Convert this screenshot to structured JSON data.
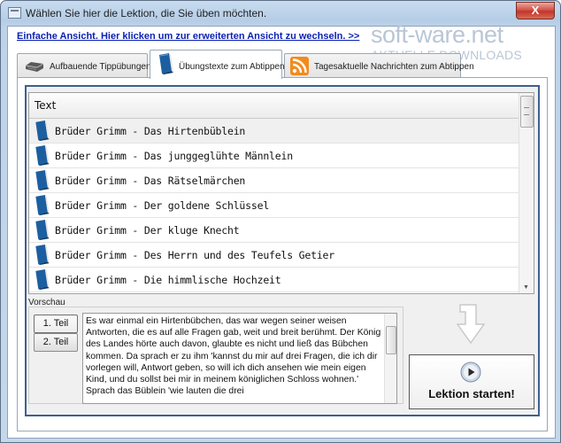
{
  "window": {
    "title": "Wählen Sie hier die Lektion, die Sie üben möchten.",
    "close_label": "X"
  },
  "simple_view_link": "Einfache Ansicht. Hier klicken um zur erweiterten Ansicht zu wechseln. >>",
  "watermark": {
    "brand": "soft-ware.net",
    "sub": "AKTUELLE DOWNLOADS"
  },
  "tabs": [
    {
      "label": "Aufbauende Tippübungen",
      "icon": "keyboard-icon",
      "active": false
    },
    {
      "label": "Übungstexte zum Abtippen",
      "icon": "book-icon",
      "active": true
    },
    {
      "label": "Tagesaktuelle Nachrichten zum Abtippen",
      "icon": "rss-icon",
      "active": false
    }
  ],
  "list": {
    "header": "Text",
    "items": [
      "Brüder Grimm - Das Hirtenbüblein",
      "Brüder Grimm - Das junggeglühte Männlein",
      "Brüder Grimm - Das Rätselmärchen",
      "Brüder Grimm - Der goldene Schlüssel",
      "Brüder Grimm - Der kluge Knecht",
      "Brüder Grimm - Des Herrn und des Teufels Getier",
      "Brüder Grimm - Die himmlische Hochzeit"
    ],
    "selected_index": 0
  },
  "preview": {
    "label": "Vorschau",
    "parts": [
      "1. Teil",
      "2. Teil"
    ],
    "active_part": 0,
    "text": "Es war einmal ein Hirtenbübchen, das war wegen seiner weisen Antworten, die es auf alle Fragen gab, weit und breit berühmt. Der König des Landes hörte auch davon, glaubte es nicht und ließ das Bübchen kommen. Da sprach er zu ihm 'kannst du mir auf drei Fragen, die ich dir vorlegen will, Antwort geben, so will ich dich ansehen wie mein eigen Kind, und du sollst bei mir in meinem königlichen Schloss wohnen.' Sprach das Büblein 'wie lauten die drei"
  },
  "start_button": {
    "label": "Lektion starten!"
  },
  "colors": {
    "link": "#0a1fb3",
    "frame": "#3e5f8f",
    "close": "#c2352a"
  }
}
